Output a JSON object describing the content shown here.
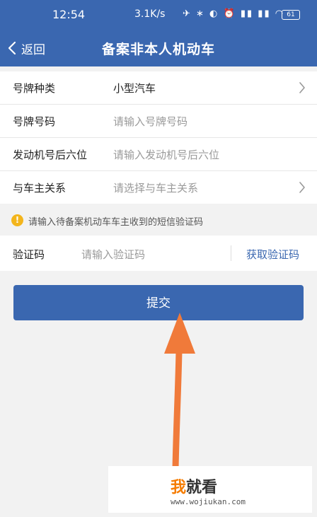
{
  "statusbar": {
    "time": "12:54",
    "speed": "3.1K/s",
    "icons": "✈ ∗ ◐ ⏰ ▮▮ ▮▮ ◠",
    "battery": "61"
  },
  "navbar": {
    "back_label": "返回",
    "title": "备案非本人机动车"
  },
  "form": {
    "rows": [
      {
        "label": "号牌种类",
        "value": "小型汽车"
      },
      {
        "label": "号牌号码",
        "placeholder": "请输入号牌号码"
      },
      {
        "label": "发动机号后六位",
        "placeholder": "请输入发动机号后六位"
      },
      {
        "label": "与车主关系",
        "placeholder": "请选择与车主关系"
      }
    ]
  },
  "notice": {
    "icon": "!",
    "text": "请输入待备案机动车车主收到的短信验证码"
  },
  "verify": {
    "label": "验证码",
    "placeholder": "请输入验证码",
    "get_code": "获取验证码"
  },
  "submit_label": "提交",
  "watermark": {
    "brand_first": "我",
    "brand_rest": "就看",
    "url": "www.wojiukan.com"
  },
  "colors": {
    "primary": "#3a67b0",
    "arrow": "#f07a3a",
    "warning": "#f3b51c"
  }
}
